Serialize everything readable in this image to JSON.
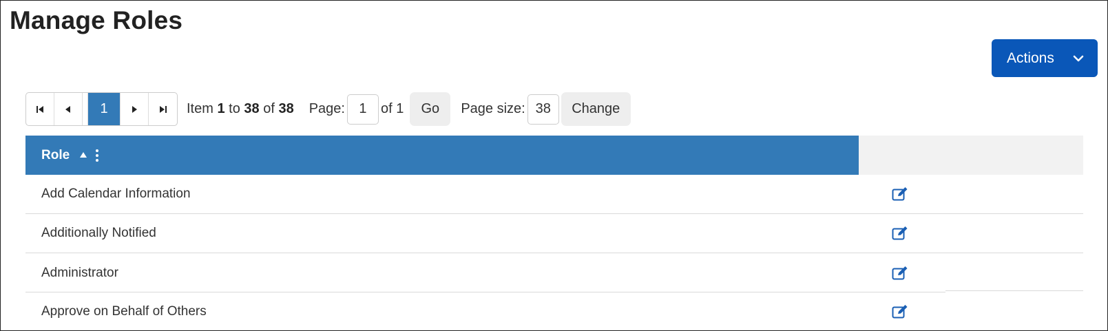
{
  "page": {
    "title": "Manage Roles"
  },
  "actions": {
    "label": "Actions",
    "icon": "chevron-down-icon"
  },
  "pager": {
    "current_page": "1",
    "item_prefix": "Item",
    "item_from": "1",
    "item_to_word": "to",
    "item_to": "38",
    "item_of_word": "of",
    "item_total": "38",
    "page_label": "Page:",
    "page_value": "1",
    "page_of": "of 1",
    "go_label": "Go",
    "pagesize_label": "Page size:",
    "pagesize_value": "38",
    "change_label": "Change"
  },
  "table": {
    "columns": [
      {
        "label": "Role",
        "sort": "ascending"
      },
      {
        "label": ""
      }
    ],
    "rows": [
      {
        "role": "Add Calendar Information"
      },
      {
        "role": "Additionally Notified"
      },
      {
        "role": "Administrator"
      },
      {
        "role": "Approve on Behalf of Others"
      }
    ]
  },
  "colors": {
    "accent": "#337ab7",
    "actions_button": "#0a57b8",
    "edit_icon": "#1a5fb4"
  }
}
